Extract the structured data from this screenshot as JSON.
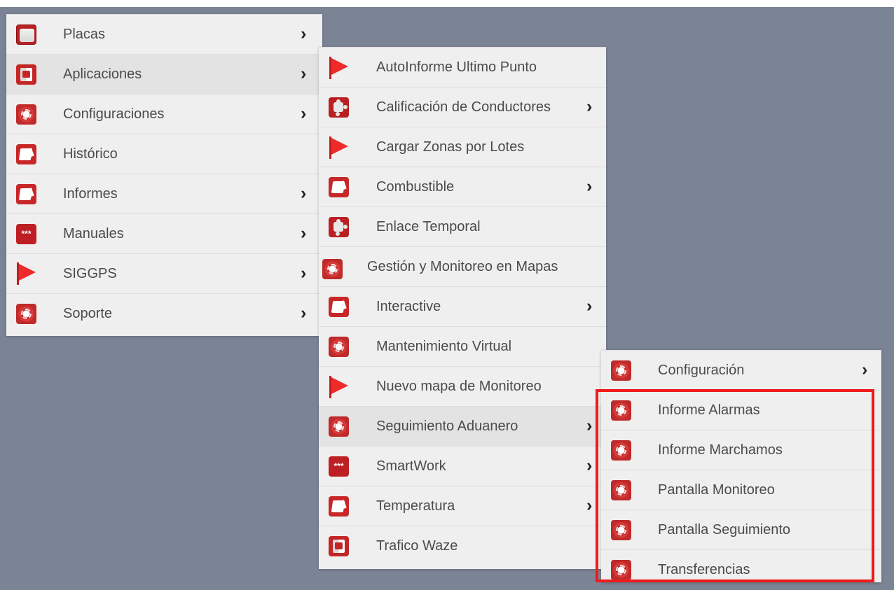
{
  "menus": {
    "level1": {
      "items": [
        {
          "label": "Placas",
          "icon": "ticket-icon",
          "arrow": "›"
        },
        {
          "label": "Aplicaciones",
          "icon": "box-icon",
          "arrow": "›"
        },
        {
          "label": "Configuraciones",
          "icon": "gear-icon",
          "arrow": "›"
        },
        {
          "label": "Histórico",
          "icon": "folder-icon",
          "arrow": ""
        },
        {
          "label": "Informes",
          "icon": "folder-icon",
          "arrow": "›"
        },
        {
          "label": "Manuales",
          "icon": "dots-icon",
          "arrow": "›"
        },
        {
          "label": "SIGGPS",
          "icon": "flag-icon",
          "arrow": "›"
        },
        {
          "label": "Soporte",
          "icon": "gear-icon",
          "arrow": "›"
        }
      ]
    },
    "level2": {
      "items": [
        {
          "label": "AutoInforme Ultimo Punto",
          "icon": "flag-icon",
          "arrow": ""
        },
        {
          "label": "Calificación de Conductores",
          "icon": "puzzle-icon",
          "arrow": "›"
        },
        {
          "label": "Cargar Zonas por Lotes",
          "icon": "flag-icon",
          "arrow": ""
        },
        {
          "label": "Combustible",
          "icon": "folder-icon",
          "arrow": "›"
        },
        {
          "label": "Enlace Temporal",
          "icon": "puzzle-icon",
          "arrow": ""
        },
        {
          "label": "Gestión y Monitoreo en Mapas",
          "icon": "gear-icon",
          "arrow": ""
        },
        {
          "label": "Interactive",
          "icon": "folder-icon",
          "arrow": "›"
        },
        {
          "label": "Mantenimiento Virtual",
          "icon": "gear-icon",
          "arrow": ""
        },
        {
          "label": "Nuevo mapa de Monitoreo",
          "icon": "flag-icon",
          "arrow": ""
        },
        {
          "label": "Seguimiento Aduanero",
          "icon": "gear-icon",
          "arrow": "›"
        },
        {
          "label": "SmartWork",
          "icon": "dots-icon",
          "arrow": "›"
        },
        {
          "label": "Temperatura",
          "icon": "folder-icon",
          "arrow": "›"
        },
        {
          "label": "Trafico Waze",
          "icon": "box-icon",
          "arrow": ""
        }
      ]
    },
    "level3": {
      "items": [
        {
          "label": "Configuración",
          "icon": "gear-icon",
          "arrow": "›"
        },
        {
          "label": "Informe Alarmas",
          "icon": "gear-icon",
          "arrow": ""
        },
        {
          "label": "Informe Marchamos",
          "icon": "gear-icon",
          "arrow": ""
        },
        {
          "label": "Pantalla Monitoreo",
          "icon": "gear-icon",
          "arrow": ""
        },
        {
          "label": "Pantalla Seguimiento",
          "icon": "gear-icon",
          "arrow": ""
        },
        {
          "label": "Transferencias",
          "icon": "gear-icon",
          "arrow": ""
        }
      ]
    }
  },
  "icon_glyphs": {
    "dots": "***"
  },
  "colors": {
    "background": "#7b8495",
    "menu": "#efefef",
    "highlight": "#ef1b1b",
    "icon_red": "#c42525"
  }
}
